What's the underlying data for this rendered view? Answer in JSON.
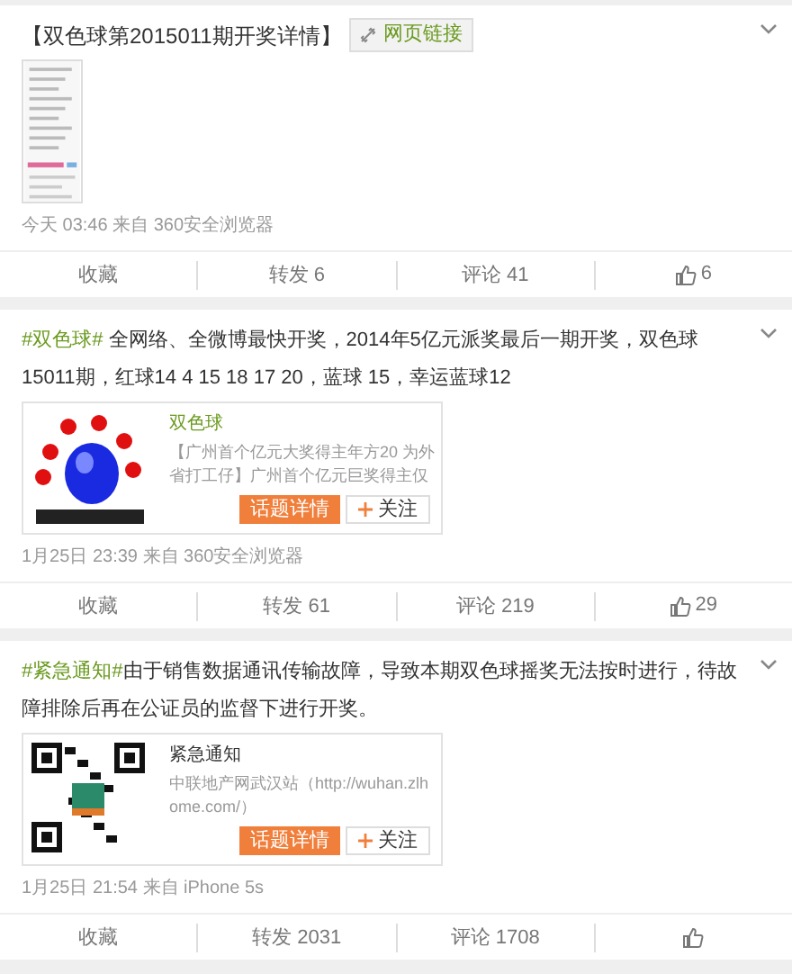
{
  "posts": [
    {
      "kind": "link",
      "text": "【双色球第2015011期开奖详情】",
      "link": "网页链接",
      "time": "今天 03:46 来自 360安全浏览器",
      "actions": [
        "收藏",
        "转发 6",
        "评论 41"
      ],
      "likes": "6"
    },
    {
      "kind": "card",
      "hashtag": "#双色球#",
      "text": " 全网络、全微博最快开奖，2014年5亿元派奖最后一期开奖，双色球15011期，红球14 4 15 18 17 20，蓝球 15，幸运蓝球12",
      "card": {
        "title": "双色球",
        "color": "#6a9a1f",
        "desc": "【广州首个亿元大奖得主年方20 为外省打工仔】广州首个亿元巨奖得主仅",
        "button": "话题详情",
        "follow": "关注"
      },
      "time": "1月25日 23:39 来自 360安全浏览器",
      "actions": [
        "收藏",
        "转发 61",
        "评论 219"
      ],
      "likes": "29"
    },
    {
      "kind": "card",
      "hashtag": "#紧急通知#",
      "text": "由于销售数据通讯传输故障，导致本期双色球摇奖无法按时进行，待故障排除后再在公证员的监督下进行开奖。",
      "card": {
        "title": "紧急通知",
        "color": "#333333",
        "desc": "中联地产网武汉站（http://wuhan.zlhome.com/）",
        "button": "话题详情",
        "follow": "关注"
      },
      "time": "1月25日 21:54 来自 iPhone 5s",
      "actions": [
        "收藏",
        "转发 2031",
        "评论 1708"
      ]
    }
  ]
}
